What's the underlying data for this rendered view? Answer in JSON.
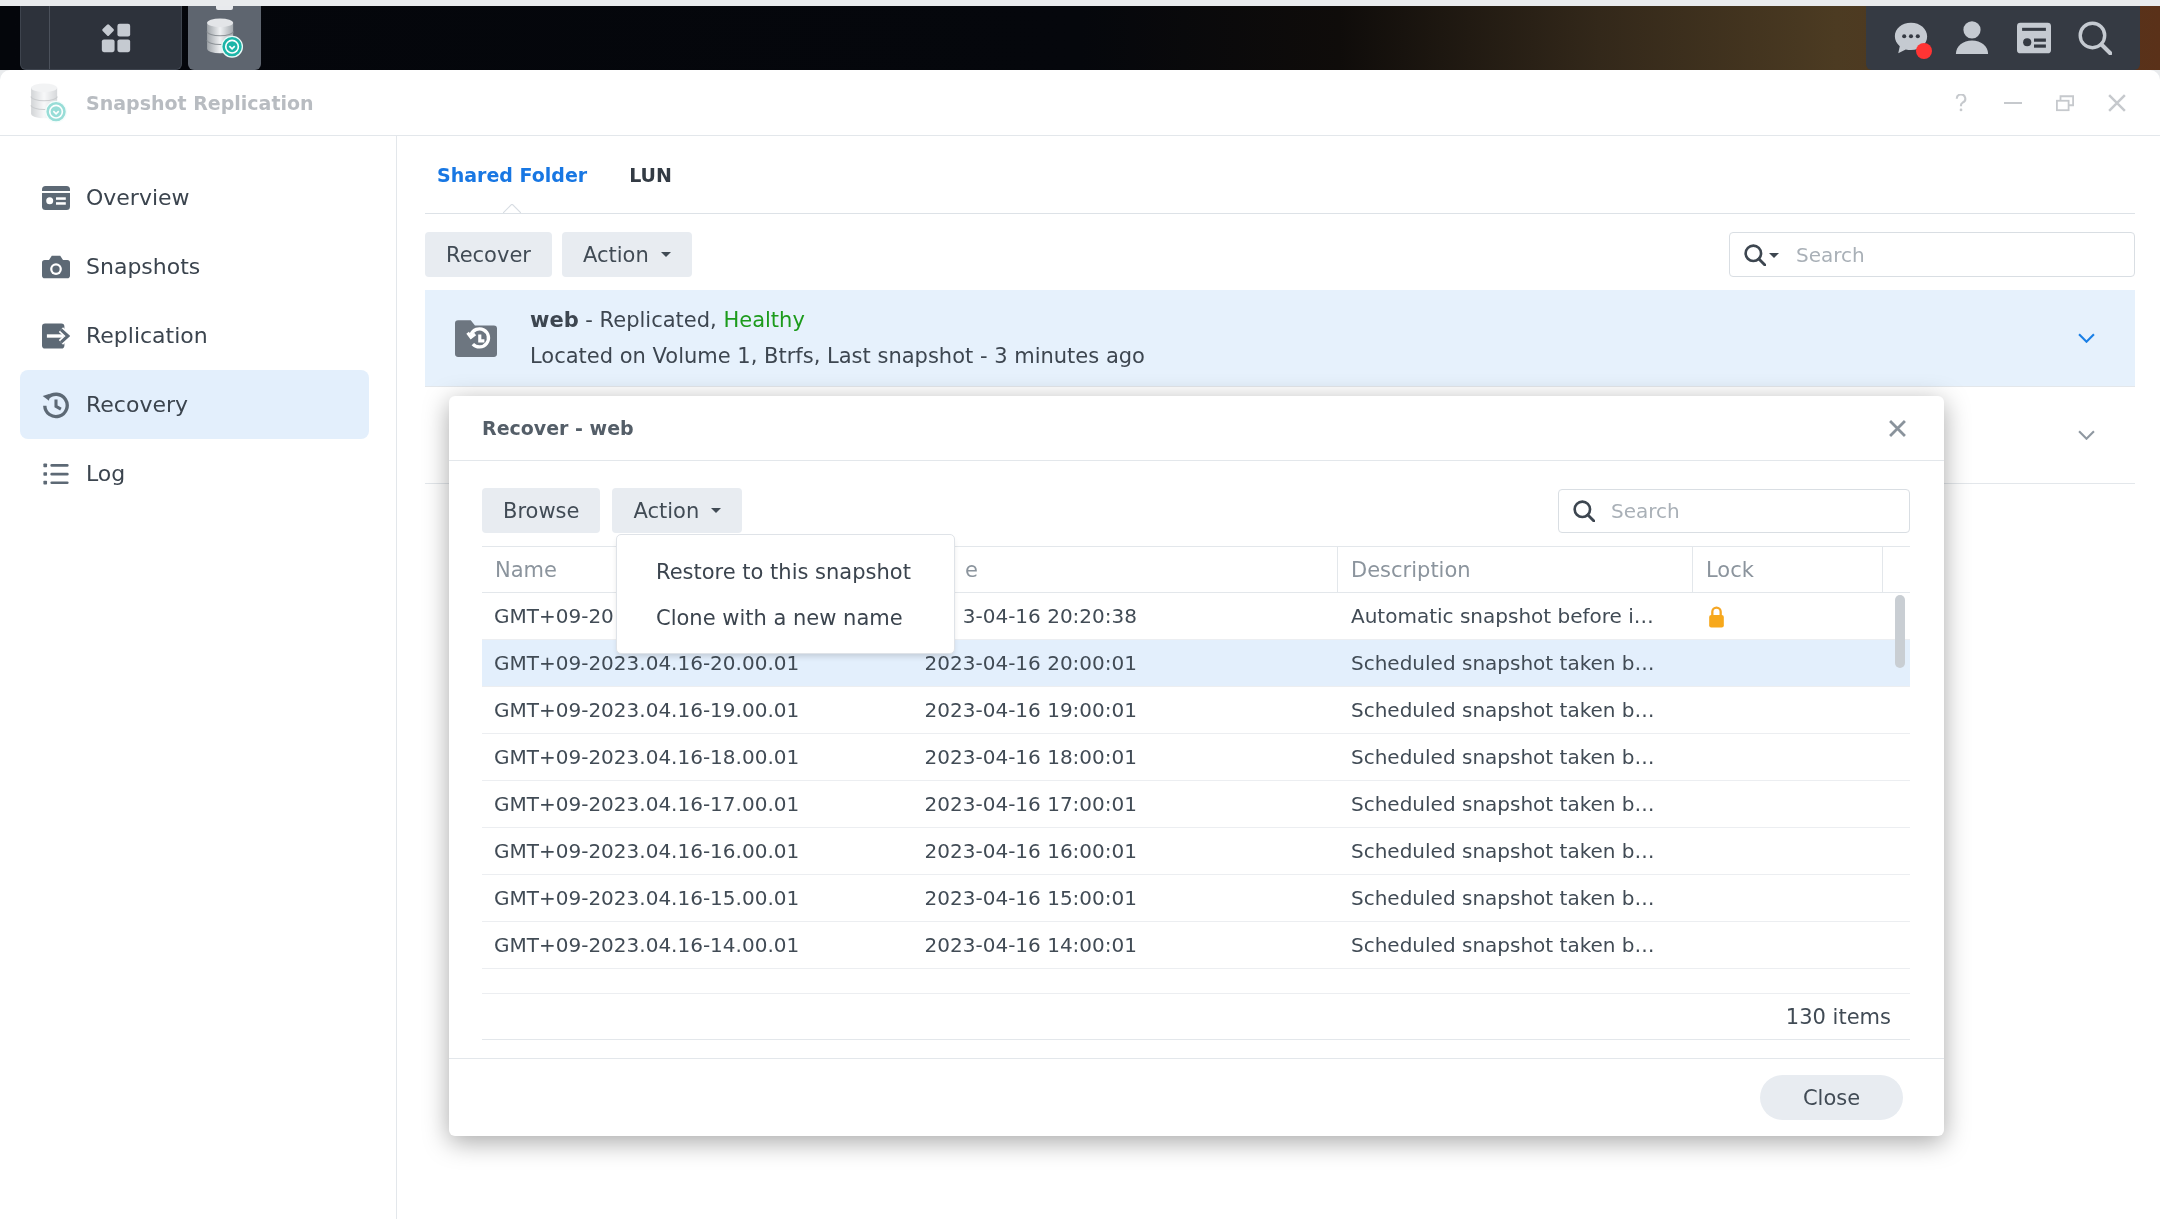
{
  "taskbar": {
    "apps": [
      {
        "selected": true
      }
    ],
    "unread_messages": true
  },
  "window": {
    "title": "Snapshot Replication"
  },
  "sidebar": {
    "items": [
      {
        "label": "Overview",
        "selected": false
      },
      {
        "label": "Snapshots",
        "selected": false
      },
      {
        "label": "Replication",
        "selected": false
      },
      {
        "label": "Recovery",
        "selected": true
      },
      {
        "label": "Log",
        "selected": false
      }
    ]
  },
  "tabs": [
    {
      "label": "Shared Folder",
      "selected": true
    },
    {
      "label": "LUN",
      "selected": false
    }
  ],
  "toolbar": {
    "buttons": [
      {
        "label": "Recover",
        "kind": "button"
      },
      {
        "label": "Action",
        "kind": "menu"
      }
    ],
    "search": {
      "placeholder": "Search",
      "kind": "menu"
    }
  },
  "shares": [
    {
      "title": "**web** - Replicated,",
      "health": "Healthy",
      "details": "Located on Volume 1, Btrfs, Last snapshot - 3 minutes ago",
      "selected": true
    },
    {
      "selected": false
    }
  ],
  "dialog": {
    "title": "Recover - web",
    "buttons": [
      {
        "label": "Browse",
        "kind": "button"
      },
      {
        "label": "Action",
        "kind": "menu"
      }
    ],
    "search": {
      "placeholder": "Search"
    },
    "menu": {
      "items": [
        "Restore to this snapshot",
        "Clone with a new name"
      ]
    },
    "table": {
      "columns": [
        "Name",
        "e",
        "Description",
        "Lock"
      ],
      "rows": [
        {
          "name": "GMT+09-20",
          "time": "3-04-16 20:20:38",
          "description": "Automatic snapshot before i…",
          "locked": true,
          "selected": false
        },
        {
          "name": "GMT+09-2023.04.16-20.00.01",
          "time": "2023-04-16 20:00:01",
          "description": "Scheduled snapshot taken b…",
          "locked": false,
          "selected": true
        },
        {
          "name": "GMT+09-2023.04.16-19.00.01",
          "time": "2023-04-16 19:00:01",
          "description": "Scheduled snapshot taken b…",
          "locked": false,
          "selected": false
        },
        {
          "name": "GMT+09-2023.04.16-18.00.01",
          "time": "2023-04-16 18:00:01",
          "description": "Scheduled snapshot taken b…",
          "locked": false,
          "selected": false
        },
        {
          "name": "GMT+09-2023.04.16-17.00.01",
          "time": "2023-04-16 17:00:01",
          "description": "Scheduled snapshot taken b…",
          "locked": false,
          "selected": false
        },
        {
          "name": "GMT+09-2023.04.16-16.00.01",
          "time": "2023-04-16 16:00:01",
          "description": "Scheduled snapshot taken b…",
          "locked": false,
          "selected": false
        },
        {
          "name": "GMT+09-2023.04.16-15.00.01",
          "time": "2023-04-16 15:00:01",
          "description": "Scheduled snapshot taken b…",
          "locked": false,
          "selected": false
        },
        {
          "name": "GMT+09-2023.04.16-14.00.01",
          "time": "2023-04-16 14:00:01",
          "description": "Scheduled snapshot taken b…",
          "locked": false,
          "selected": false
        }
      ]
    },
    "item_count": "130 items",
    "close_button": "Close"
  }
}
